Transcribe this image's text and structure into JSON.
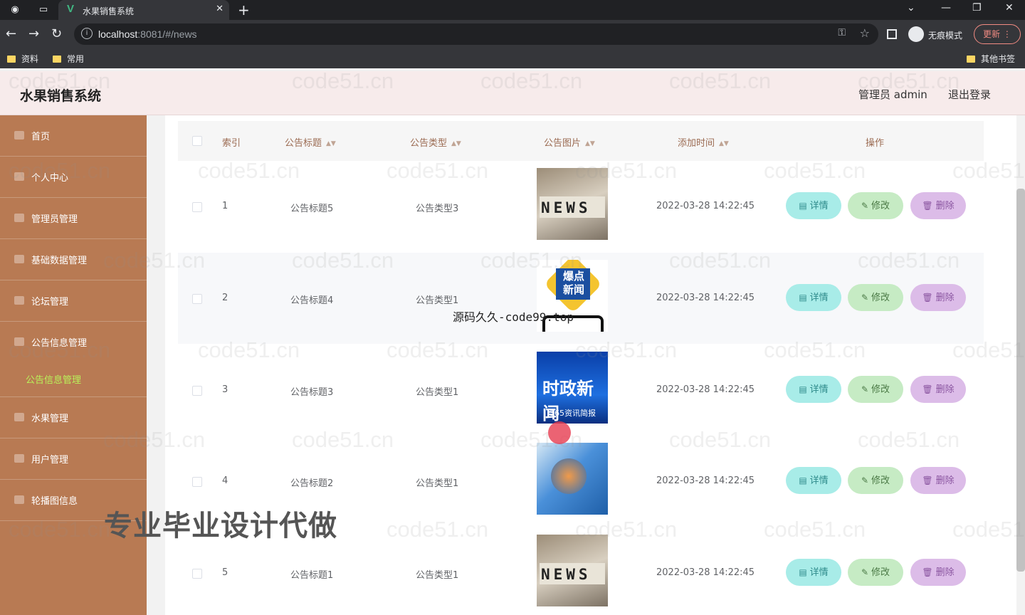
{
  "browser": {
    "tab_title": "水果销售系统",
    "url_host": "localhost",
    "url_rest": ":8081/#/news",
    "incognito_label": "无痕模式",
    "update_label": "更新",
    "bookmarks": [
      "资料",
      "常用"
    ],
    "other_bookmarks": "其他书签"
  },
  "header": {
    "title": "水果销售系统",
    "admin": "管理员 admin",
    "logout": "退出登录"
  },
  "sidebar": {
    "items": [
      {
        "label": "首页"
      },
      {
        "label": "个人中心"
      },
      {
        "label": "管理员管理"
      },
      {
        "label": "基础数据管理"
      },
      {
        "label": "论坛管理"
      },
      {
        "label": "公告信息管理"
      },
      {
        "label": "水果管理"
      },
      {
        "label": "用户管理"
      },
      {
        "label": "轮播图信息"
      }
    ],
    "active_sub": "公告信息管理"
  },
  "table": {
    "headers": [
      "索引",
      "公告标题",
      "公告类型",
      "公告图片",
      "添加时间",
      "操作"
    ],
    "rows": [
      {
        "index": "1",
        "title": "公告标题5",
        "type": "公告类型3",
        "time": "2022-03-28 14:22:45",
        "img": "news"
      },
      {
        "index": "2",
        "title": "公告标题4",
        "type": "公告类型1",
        "time": "2022-03-28 14:22:45",
        "img": "baodian"
      },
      {
        "index": "3",
        "title": "公告标题3",
        "type": "公告类型1",
        "time": "2022-03-28 14:22:45",
        "img": "shizheng"
      },
      {
        "index": "4",
        "title": "公告标题2",
        "type": "公告类型1",
        "time": "2022-03-28 14:22:45",
        "img": "blue"
      },
      {
        "index": "5",
        "title": "公告标题1",
        "type": "公告类型1",
        "time": "2022-03-28 14:22:45",
        "img": "news"
      }
    ],
    "btn_detail": "详情",
    "btn_edit": "修改",
    "btn_delete": "删除"
  },
  "image_texts": {
    "news": "NEWS",
    "baodian": "爆点新闻",
    "shizheng": "时政新闻",
    "shizheng_sub": "365资讯简报"
  },
  "overlays": {
    "site": "源码久久-code99.top",
    "ad": "专业毕业设计代做",
    "watermark": "code51.cn"
  }
}
